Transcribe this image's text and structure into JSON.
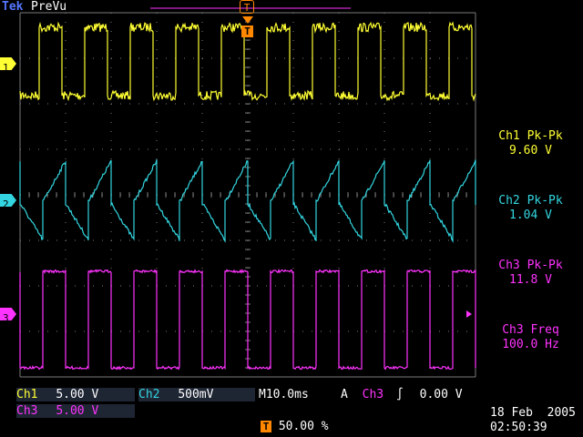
{
  "header": {
    "brand": "Tek",
    "mode": "PreVu",
    "trigger_marker": "T"
  },
  "colors": {
    "ch1": "#ffff33",
    "ch2": "#33d6e0",
    "ch3": "#ff33ff",
    "trigger": "#ff8800",
    "grid": "#7a7a7a"
  },
  "channel_markers": {
    "ch1": "1",
    "ch2": "2",
    "ch3": "3"
  },
  "measurements": [
    {
      "label": "Ch1 Pk-Pk",
      "value": "9.60 V"
    },
    {
      "label": "Ch2 Pk-Pk",
      "value": "1.04 V"
    },
    {
      "label": "Ch3 Pk-Pk",
      "value": "11.8 V"
    },
    {
      "label": "Ch3 Freq",
      "value": "100.0 Hz"
    }
  ],
  "status_bar": {
    "ch1_label": "Ch1",
    "ch1_scale": "5.00 V",
    "ch2_label": "Ch2",
    "ch2_scale": "500mV",
    "timebase_label": "M",
    "timebase": "10.0ms",
    "trigger_mode": "A",
    "trigger_source": "Ch3",
    "trigger_level": "0.00 V",
    "ch3_label": "Ch3",
    "ch3_scale": "5.00 V",
    "trigger_position_icon": "T",
    "trigger_position": "50.00 %",
    "date": "18 Feb  2005",
    "time": "02:50:39"
  },
  "waveforms": {
    "ch1": {
      "period_ms": 10,
      "shape": "square",
      "level_v": 9.6
    },
    "ch2": {
      "period_ms": 10,
      "shape": "sawtooth",
      "level_v": 1.04
    },
    "ch3": {
      "frequency_hz": 100.0,
      "shape": "square",
      "level_v": 11.8
    }
  }
}
